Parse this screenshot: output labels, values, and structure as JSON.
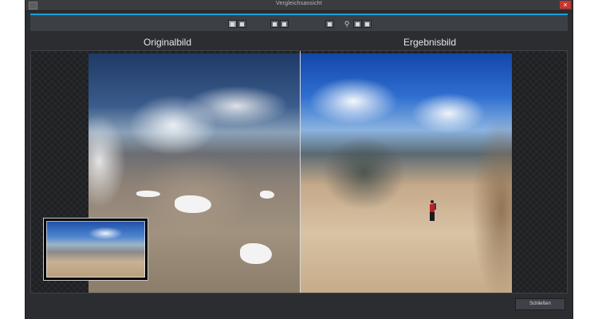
{
  "window": {
    "title": "Vergleichsansicht",
    "close_glyph": "×"
  },
  "toolbar": {
    "accent_color": "#1f9ed8",
    "groups": [
      {
        "icons": [
          "split-view-icon",
          "side-by-side-icon"
        ]
      },
      {
        "icons": [
          "original-only-icon",
          "result-only-icon"
        ]
      },
      {
        "icons": [
          "single-view-icon"
        ]
      },
      {
        "icons": [
          "magnifier-icon",
          "zoom-fit-icon",
          "zoom-actual-icon"
        ]
      }
    ]
  },
  "panels": {
    "left_label": "Originalbild",
    "right_label": "Ergebnisbild"
  },
  "footer": {
    "close_label": "Schließen"
  }
}
